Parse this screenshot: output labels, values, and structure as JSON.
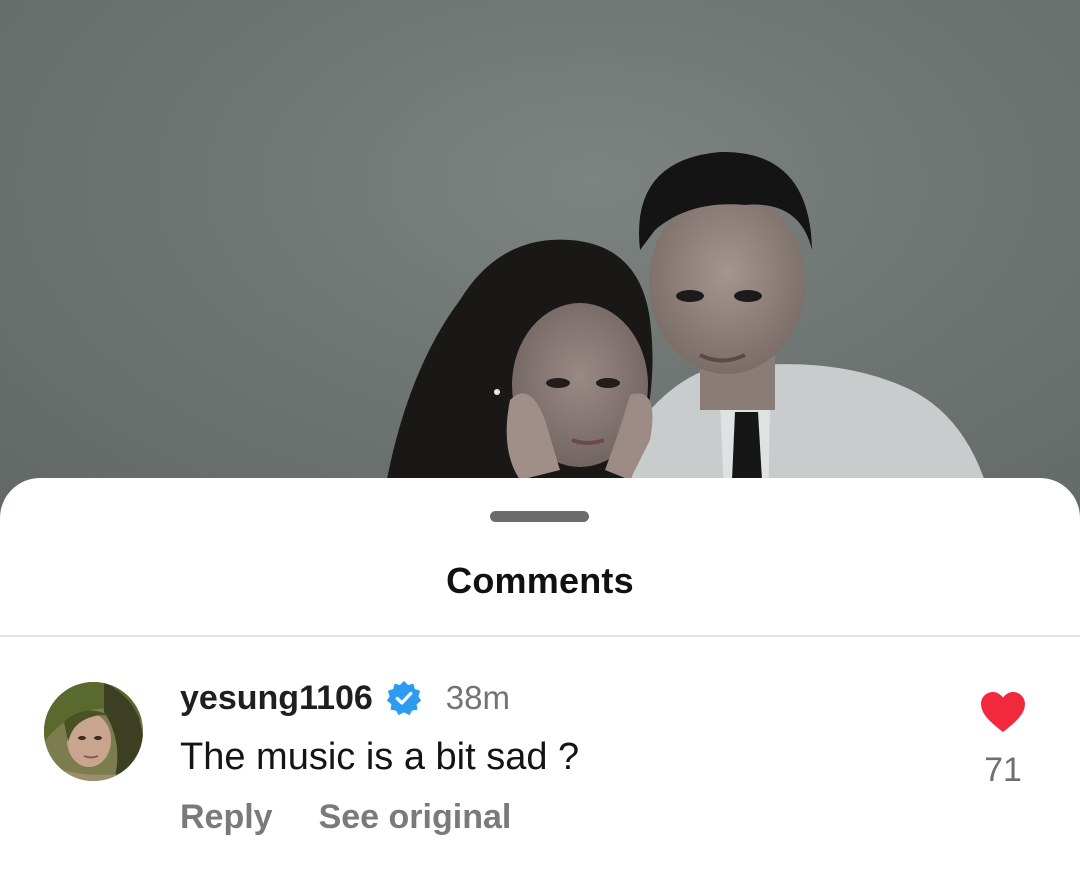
{
  "sheet": {
    "title": "Comments"
  },
  "comment": {
    "username": "yesung1106",
    "verified": true,
    "timestamp": "38m",
    "text": "The music is a bit sad ?",
    "actions": {
      "reply": "Reply",
      "see_original": "See original"
    },
    "likes": "71",
    "avatar_icon": "user-avatar"
  },
  "colors": {
    "heart": "#f2283c",
    "verified_badge": "#2d9cf0",
    "photo_background": "#6f7572"
  },
  "icons": {
    "verified": "verified-badge-icon",
    "like": "heart-icon"
  }
}
